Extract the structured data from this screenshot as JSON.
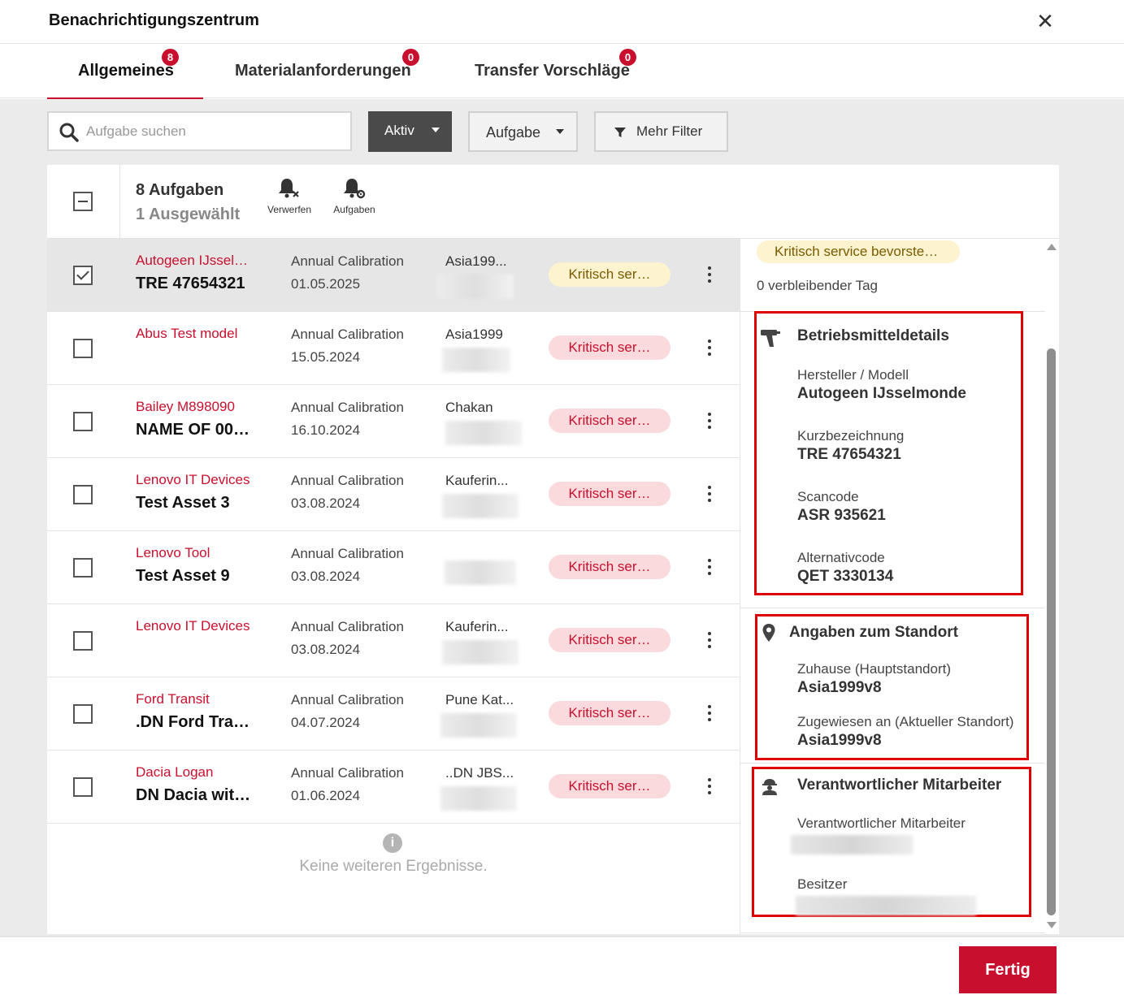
{
  "header": {
    "title": "Benachrichtigungszentrum",
    "close_icon": "close-icon"
  },
  "tabs": [
    {
      "label": "Allgemeines",
      "badge": "8",
      "active": true
    },
    {
      "label": "Materialanforderungen",
      "badge": "0",
      "active": false
    },
    {
      "label": "Transfer Vorschläge",
      "badge": "0",
      "active": false
    }
  ],
  "toolbar": {
    "search_placeholder": "Aufgabe suchen",
    "search_value": "",
    "status_filter": "Aktiv",
    "type_filter": "Aufgabe",
    "more_filters": "Mehr Filter"
  },
  "list": {
    "count_title": "8 Aufgaben",
    "selected_count": "1 Ausgewählt",
    "actions": [
      {
        "label": "Verwerfen",
        "icon": "bell-dismiss-icon"
      },
      {
        "label": "Aufgaben",
        "icon": "bell-settings-icon"
      }
    ],
    "rows": [
      {
        "manufacturer": "Autogeen IJssel…",
        "name": "TRE 47654321",
        "task": "Annual Calibration",
        "date": "01.05.2025",
        "location": "Asia199...",
        "status": "Kritisch ser…",
        "status_kind": "warning",
        "selected": true
      },
      {
        "manufacturer": "Abus Test model",
        "name": "",
        "task": "Annual Calibration",
        "date": "15.05.2024",
        "location": "Asia1999",
        "status": "Kritisch ser…",
        "status_kind": "critical",
        "selected": false
      },
      {
        "manufacturer": "Bailey M898090",
        "name": "NAME OF 00…",
        "task": "Annual Calibration",
        "date": "16.10.2024",
        "location": "Chakan",
        "status": "Kritisch ser…",
        "status_kind": "critical",
        "selected": false
      },
      {
        "manufacturer": "Lenovo IT Devices",
        "name": "Test Asset 3",
        "task": "Annual Calibration",
        "date": "03.08.2024",
        "location": "Kauferin...",
        "status": "Kritisch ser…",
        "status_kind": "critical",
        "selected": false
      },
      {
        "manufacturer": "Lenovo Tool",
        "name": "Test Asset 9",
        "task": "Annual Calibration",
        "date": "03.08.2024",
        "location": "",
        "status": "Kritisch ser…",
        "status_kind": "critical",
        "selected": false
      },
      {
        "manufacturer": "Lenovo IT Devices",
        "name": "",
        "task": "Annual Calibration",
        "date": "03.08.2024",
        "location": "Kauferin...",
        "status": "Kritisch ser…",
        "status_kind": "critical",
        "selected": false
      },
      {
        "manufacturer": "Ford Transit",
        "name": ".DN Ford Tra…",
        "task": "Annual Calibration",
        "date": "04.07.2024",
        "location": "Pune Kat...",
        "status": "Kritisch ser…",
        "status_kind": "critical",
        "selected": false
      },
      {
        "manufacturer": "Dacia Logan",
        "name": "DN Dacia wit…",
        "task": "Annual Calibration",
        "date": "01.06.2024",
        "location": "..DN JBS...",
        "status": "Kritisch ser…",
        "status_kind": "critical",
        "selected": false
      }
    ],
    "no_more_text": "Keine weiteren Ergebnisse."
  },
  "detail": {
    "status": "Kritisch service bevorstehend",
    "remaining": "0 verbleibender Tag",
    "asset_section": {
      "title": "Betriebsmitteldetails",
      "icon": "drill-icon",
      "fields": [
        {
          "label": "Hersteller / Modell",
          "value": "Autogeen IJsselmonde"
        },
        {
          "label": "Kurzbezeichnung",
          "value": "TRE 47654321"
        },
        {
          "label": "Scancode",
          "value": "ASR 935621"
        },
        {
          "label": "Alternativcode",
          "value": "QET 3330134"
        }
      ]
    },
    "location_section": {
      "title": "Angaben zum Standort",
      "icon": "map-pin-icon",
      "fields": [
        {
          "label": "Zuhause (Hauptstandort)",
          "value": "Asia1999v8"
        },
        {
          "label": "Zugewiesen an (Aktueller Standort)",
          "value": "Asia1999v8"
        }
      ]
    },
    "employee_section": {
      "title": "Verantwortlicher Mitarbeiter",
      "icon": "worker-icon",
      "fields": [
        {
          "label": "Verantwortlicher Mitarbeiter",
          "value": ""
        },
        {
          "label": "Besitzer",
          "value": ""
        }
      ]
    }
  },
  "footer": {
    "done_label": "Fertig"
  },
  "colors": {
    "accent": "#c8102e",
    "highlight_box": "#e00000",
    "warning_bg": "#fdf3cf",
    "critical_bg": "#fadadd"
  }
}
